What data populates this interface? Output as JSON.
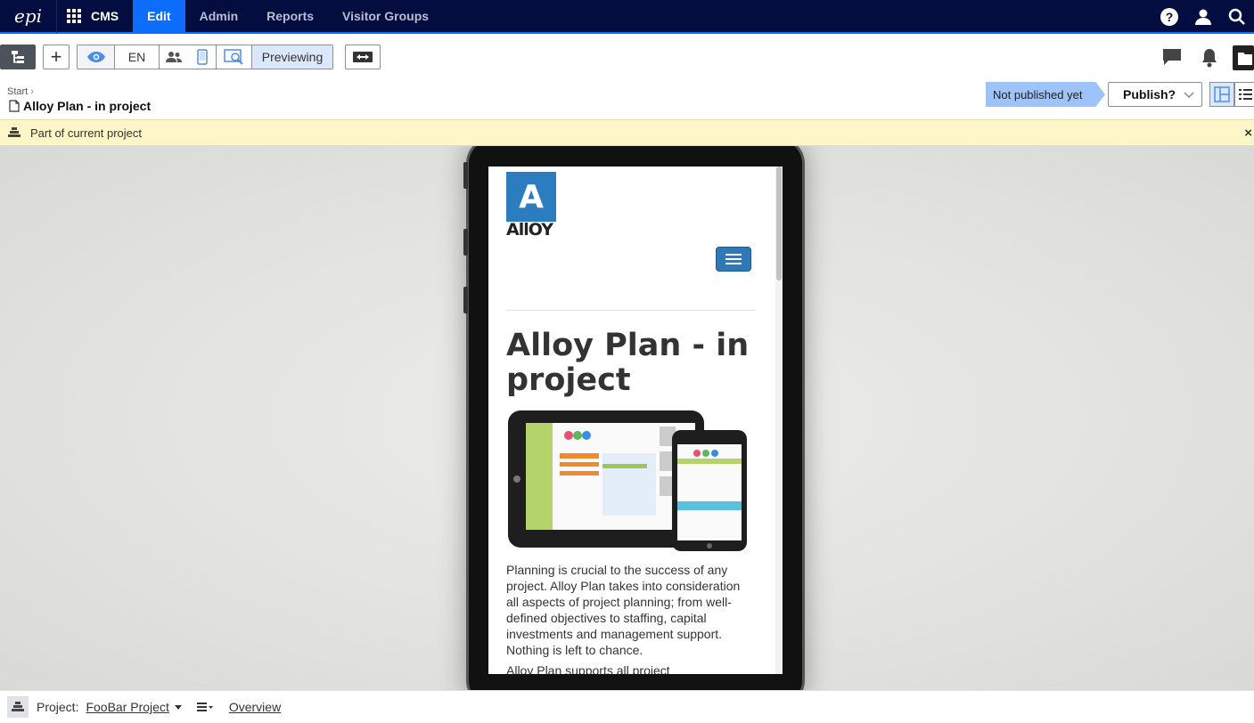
{
  "topnav": {
    "logo_text": "epi",
    "product": "CMS",
    "tabs": [
      {
        "label": "Edit",
        "active": true
      },
      {
        "label": "Admin",
        "active": false
      },
      {
        "label": "Reports",
        "active": false
      },
      {
        "label": "Visitor Groups",
        "active": false
      }
    ],
    "help_label": "?",
    "accent_color": "#0d6efd",
    "bar_color": "#030d3f"
  },
  "toolbar": {
    "add_label": "+",
    "language": "EN",
    "previewing_label": "Previewing"
  },
  "breadcrumb": {
    "start": "Start",
    "page_title": "Alloy Plan - in project"
  },
  "publish": {
    "status": "Not published yet",
    "button_label": "Publish?"
  },
  "notice": {
    "text": "Part of current project",
    "close": "×"
  },
  "preview": {
    "logo_letter": "A",
    "logo_word": "AllOY",
    "title": "Alloy Plan - in project",
    "body": "Planning is crucial to the success of any project. Alloy Plan takes into consideration all aspects of project planning; from well-defined objectives to staffing, capital investments and management support. Nothing is left to chance.",
    "body_cut": "Alloy Plan supports all project"
  },
  "bottombar": {
    "project_label": "Project:",
    "project_name": "FooBar Project",
    "overview_link": "Overview"
  }
}
